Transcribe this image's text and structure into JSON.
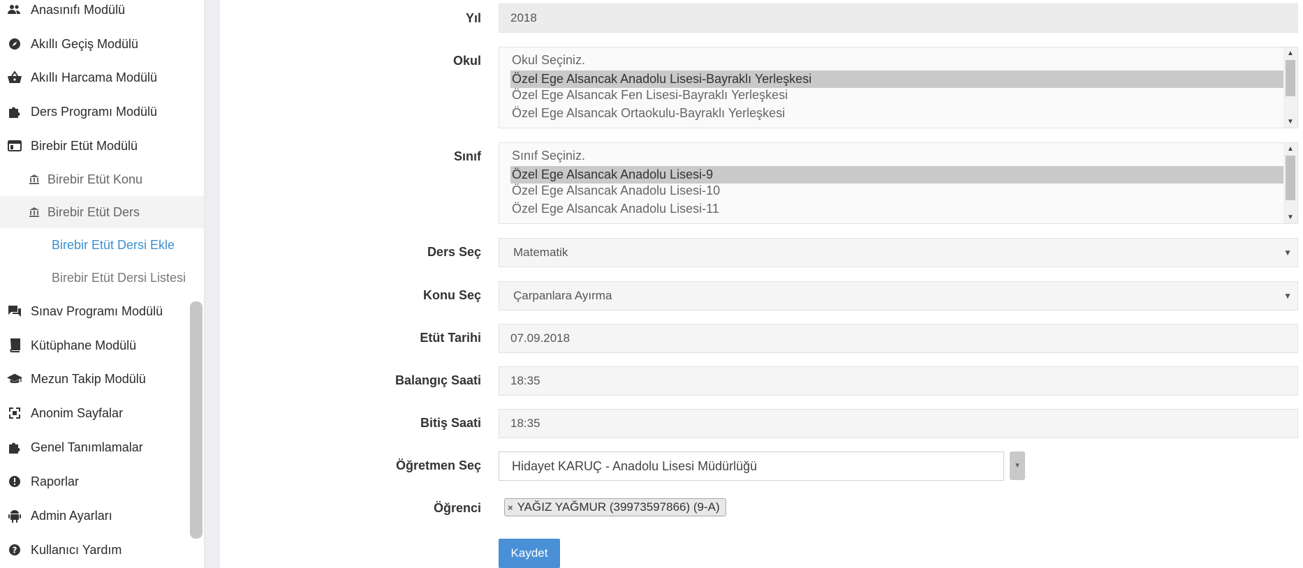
{
  "sidebar": {
    "items": [
      {
        "label": "Anasınıfı Modülü",
        "icon": "users-icon"
      },
      {
        "label": "Akıllı Geçiş Modülü",
        "icon": "compass-icon"
      },
      {
        "label": "Akıllı Harcama Modülü",
        "icon": "basket-icon"
      },
      {
        "label": "Ders Programı Modülü",
        "icon": "puzzle-icon"
      },
      {
        "label": "Birebir Etüt Modülü",
        "icon": "window-icon"
      },
      {
        "label": "Birebir Etüt Konu",
        "icon": "bank-icon"
      },
      {
        "label": "Birebir Etüt Ders",
        "icon": "bank-icon"
      },
      {
        "label": "Birebir Etüt Dersi Ekle"
      },
      {
        "label": "Birebir Etüt Dersi Listesi"
      },
      {
        "label": "Sınav Programı Modülü",
        "icon": "chat-icon"
      },
      {
        "label": "Kütüphane Modülü",
        "icon": "book-icon"
      },
      {
        "label": "Mezun Takip Modülü",
        "icon": "graduation-cap-icon"
      },
      {
        "label": "Anonim Sayfalar",
        "icon": "expand-icon"
      },
      {
        "label": "Genel Tanımlamalar",
        "icon": "puzzle-icon"
      },
      {
        "label": "Raporlar",
        "icon": "alert-icon"
      },
      {
        "label": "Admin Ayarları",
        "icon": "android-icon"
      },
      {
        "label": "Kullanıcı Yardım",
        "icon": "help-icon"
      }
    ]
  },
  "form": {
    "year": {
      "label": "Yıl",
      "value": "2018"
    },
    "school": {
      "label": "Okul",
      "options": [
        "Okul Seçiniz.",
        "Özel Ege Alsancak Anadolu Lisesi-Bayraklı Yerleşkesi",
        "Özel Ege Alsancak Fen Lisesi-Bayraklı Yerleşkesi",
        "Özel Ege Alsancak Ortaokulu-Bayraklı Yerleşkesi"
      ],
      "selected_index": 1
    },
    "class": {
      "label": "Sınıf",
      "options": [
        "Sınıf Seçiniz.",
        "Özel Ege Alsancak Anadolu Lisesi-9",
        "Özel Ege Alsancak Anadolu Lisesi-10",
        "Özel Ege Alsancak Anadolu Lisesi-11"
      ],
      "selected_index": 1
    },
    "lesson": {
      "label": "Ders Seç",
      "value": "Matematik"
    },
    "topic": {
      "label": "Konu Seç",
      "value": "Çarpanlara Ayırma"
    },
    "date": {
      "label": "Etüt Tarihi",
      "value": "07.09.2018"
    },
    "start": {
      "label": "Balangıç Saati",
      "value": "18:35"
    },
    "end": {
      "label": "Bitiş Saati",
      "value": "18:35"
    },
    "teacher": {
      "label": "Öğretmen Seç",
      "value": "Hidayet KARUÇ - Anadolu Lisesi Müdürlüğü"
    },
    "student": {
      "label": "Öğrenci",
      "tag": "YAĞIZ YAĞMUR (39973597866) (9-A)"
    },
    "save_label": "Kaydet"
  }
}
